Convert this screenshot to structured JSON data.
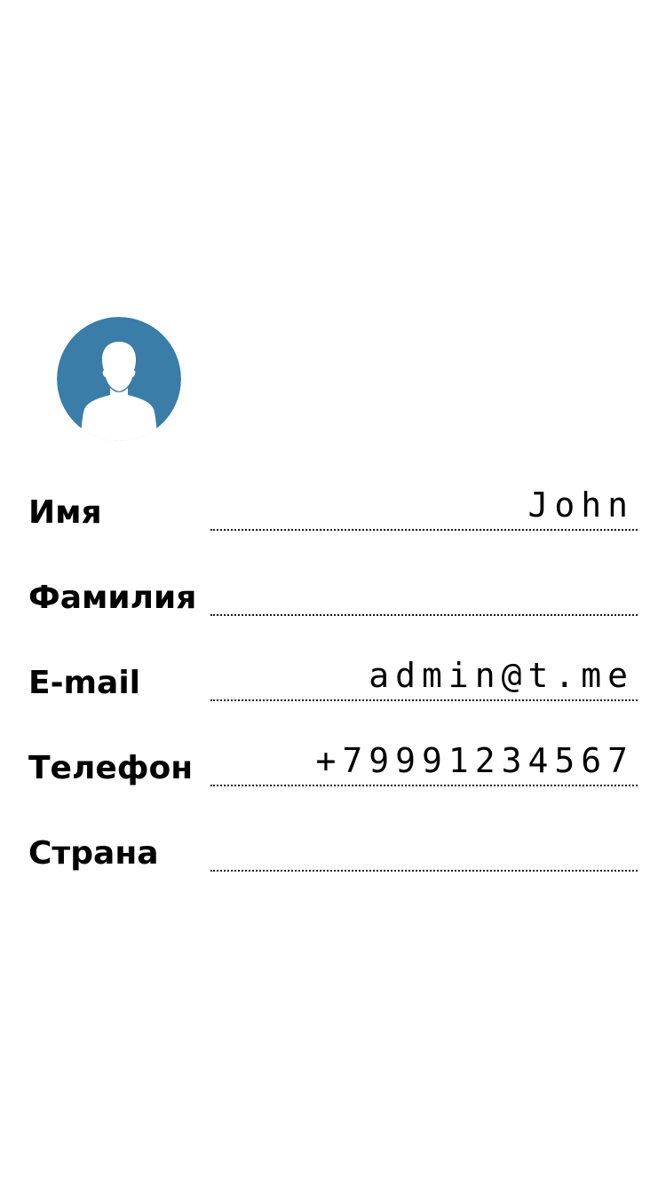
{
  "profile": {
    "avatar_icon": "user-avatar-icon",
    "avatar_color": "#3a7da8"
  },
  "fields": [
    {
      "label": "Имя",
      "value": "John"
    },
    {
      "label": "Фамилия",
      "value": ""
    },
    {
      "label": "E-mail",
      "value": "admin@t.me"
    },
    {
      "label": "Телефон",
      "value": "+79991234567"
    },
    {
      "label": "Страна",
      "value": ""
    }
  ]
}
